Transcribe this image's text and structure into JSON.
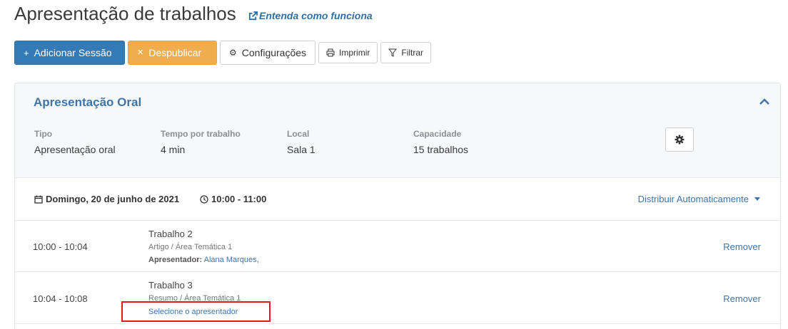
{
  "header": {
    "title": "Apresentação de trabalhos",
    "help_link": "Entenda como funciona"
  },
  "toolbar": {
    "add_session": "Adicionar Sessão",
    "unpublish": "Despublicar",
    "settings": "Configurações",
    "print": "Imprimir",
    "filter": "Filtrar"
  },
  "session": {
    "title": "Apresentação Oral",
    "meta": [
      {
        "label": "Tipo",
        "value": "Apresentação oral"
      },
      {
        "label": "Tempo por trabalho",
        "value": "4 min"
      },
      {
        "label": "Local",
        "value": "Sala 1"
      },
      {
        "label": "Capacidade",
        "value": "15 trabalhos"
      }
    ],
    "day": {
      "date": "Domingo, 20 de junho de 2021",
      "time": "10:00 - 11:00",
      "auto_distribute": "Distribuir Automaticamente"
    },
    "slots": [
      {
        "time": "10:00 - 10:04",
        "title": "Trabalho 2",
        "subtitle": "Artigo / Área Temática 1",
        "presenter_label": "Apresentador:",
        "presenter": "Alana Marques,",
        "remove": "Remover"
      },
      {
        "time": "10:04 - 10:08",
        "title": "Trabalho 3",
        "subtitle": "Resumo / Área Temática 1",
        "select_presenter": "Selecione o apresentador",
        "remove": "Remover"
      }
    ]
  },
  "colors": {
    "primary": "#337ab7",
    "warning": "#f0ad4e",
    "link": "#3f74a8",
    "highlight": "#e01b1b"
  }
}
